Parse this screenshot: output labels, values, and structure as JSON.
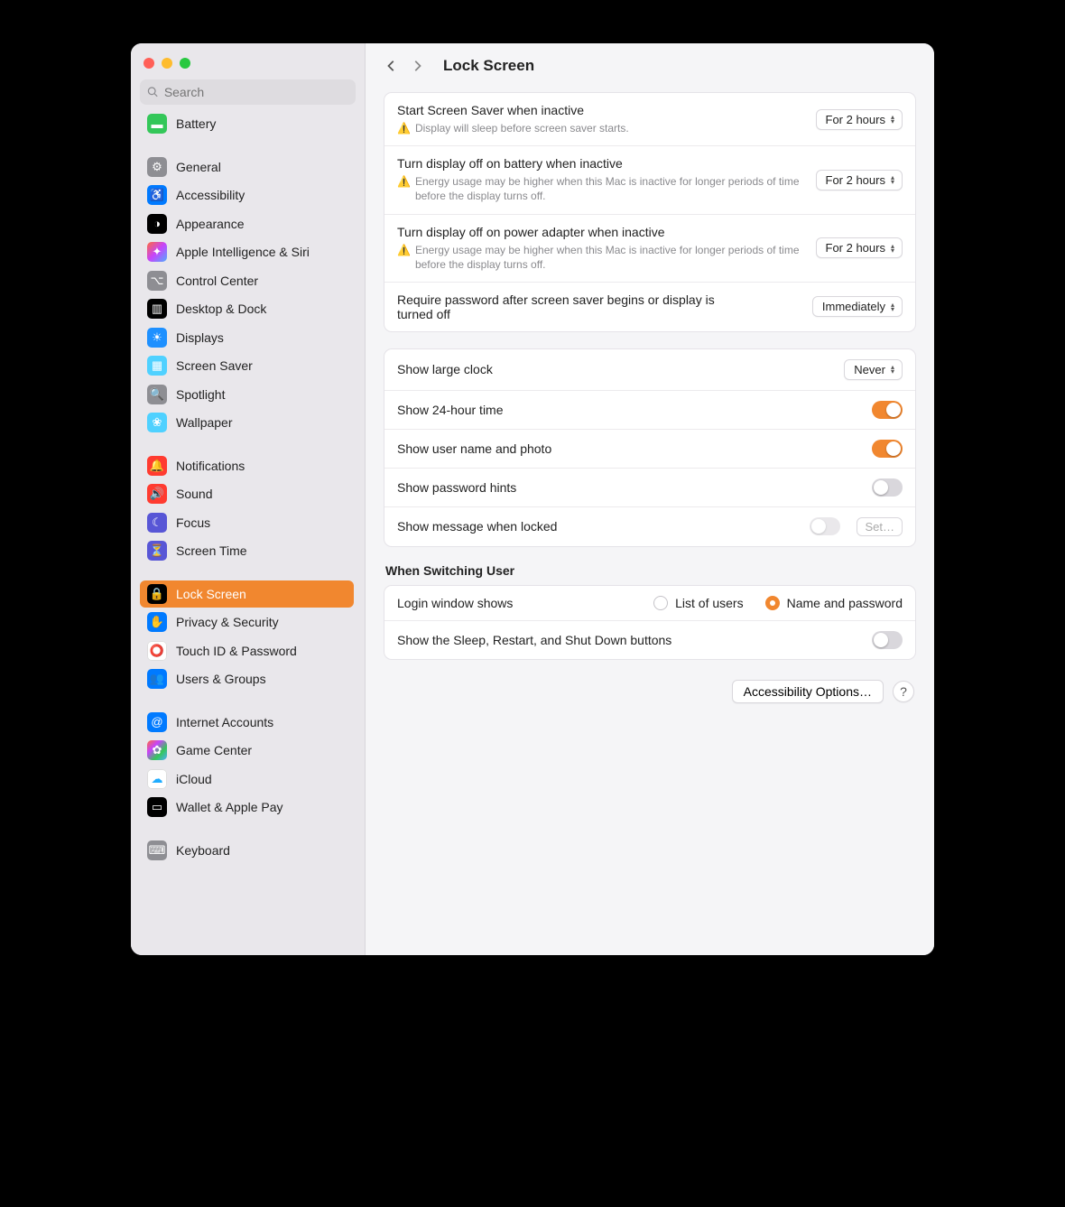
{
  "search": {
    "placeholder": "Search"
  },
  "sidebar": {
    "items": [
      {
        "label": "Battery",
        "bg": "#34c759",
        "glyph": "▬"
      },
      {
        "spacer": true
      },
      {
        "label": "General",
        "bg": "#8e8e93",
        "glyph": "⚙"
      },
      {
        "label": "Accessibility",
        "bg": "#007aff",
        "glyph": "♿"
      },
      {
        "label": "Appearance",
        "bg": "#000000",
        "glyph": "◑"
      },
      {
        "label": "Apple Intelligence & Siri",
        "bg": "linear-gradient(135deg,#ff6a3d,#c644fc,#4facfe)",
        "glyph": "✦"
      },
      {
        "label": "Control Center",
        "bg": "#8e8e93",
        "glyph": "⌥"
      },
      {
        "label": "Desktop & Dock",
        "bg": "#000000",
        "glyph": "▥"
      },
      {
        "label": "Displays",
        "bg": "#1e90ff",
        "glyph": "☀"
      },
      {
        "label": "Screen Saver",
        "bg": "#4fd1ff",
        "glyph": "▦"
      },
      {
        "label": "Spotlight",
        "bg": "#8e8e93",
        "glyph": "🔍"
      },
      {
        "label": "Wallpaper",
        "bg": "#4fd1ff",
        "glyph": "❀"
      },
      {
        "spacer": true
      },
      {
        "label": "Notifications",
        "bg": "#ff3b30",
        "glyph": "🔔"
      },
      {
        "label": "Sound",
        "bg": "#ff3b30",
        "glyph": "🔊"
      },
      {
        "label": "Focus",
        "bg": "#5856d6",
        "glyph": "☾"
      },
      {
        "label": "Screen Time",
        "bg": "#5856d6",
        "glyph": "⏳"
      },
      {
        "spacer": true
      },
      {
        "label": "Lock Screen",
        "bg": "#000000",
        "glyph": "🔒",
        "selected": true
      },
      {
        "label": "Privacy & Security",
        "bg": "#007aff",
        "glyph": "✋"
      },
      {
        "label": "Touch ID & Password",
        "bg": "#ffffff",
        "glyph": "⭕",
        "glyphColor": "#ff3b30"
      },
      {
        "label": "Users & Groups",
        "bg": "#007aff",
        "glyph": "👥"
      },
      {
        "spacer": true
      },
      {
        "label": "Internet Accounts",
        "bg": "#007aff",
        "glyph": "@"
      },
      {
        "label": "Game Center",
        "bg": "linear-gradient(135deg,#ff6a3d,#c644fc,#34c759,#4facfe)",
        "glyph": "✿"
      },
      {
        "label": "iCloud",
        "bg": "#ffffff",
        "glyph": "☁",
        "glyphColor": "#1eacff"
      },
      {
        "label": "Wallet & Apple Pay",
        "bg": "#000000",
        "glyph": "▭"
      },
      {
        "spacer": true
      },
      {
        "label": "Keyboard",
        "bg": "#8e8e93",
        "glyph": "⌨"
      }
    ]
  },
  "header": {
    "title": "Lock Screen"
  },
  "group1": {
    "r0": {
      "title": "Start Screen Saver when inactive",
      "warn": "Display will sleep before screen saver starts.",
      "value": "For 2 hours"
    },
    "r1": {
      "title": "Turn display off on battery when inactive",
      "warn": "Energy usage may be higher when this Mac is inactive for longer periods of time before the display turns off.",
      "value": "For 2 hours"
    },
    "r2": {
      "title": "Turn display off on power adapter when inactive",
      "warn": "Energy usage may be higher when this Mac is inactive for longer periods of time before the display turns off.",
      "value": "For 2 hours"
    },
    "r3": {
      "title": "Require password after screen saver begins or display is turned off",
      "value": "Immediately"
    }
  },
  "group2": {
    "r0": {
      "title": "Show large clock",
      "value": "Never"
    },
    "r1": {
      "title": "Show 24-hour time",
      "on": true
    },
    "r2": {
      "title": "Show user name and photo",
      "on": true
    },
    "r3": {
      "title": "Show password hints",
      "on": false
    },
    "r4": {
      "title": "Show message when locked",
      "on": false,
      "btn": "Set…"
    }
  },
  "switching": {
    "title": "When Switching User",
    "r0": {
      "title": "Login window shows",
      "opt0": "List of users",
      "opt1": "Name and password",
      "checked": 1
    },
    "r1": {
      "title": "Show the Sleep, Restart, and Shut Down buttons",
      "on": false
    }
  },
  "footer": {
    "access": "Accessibility Options…",
    "help": "?"
  }
}
